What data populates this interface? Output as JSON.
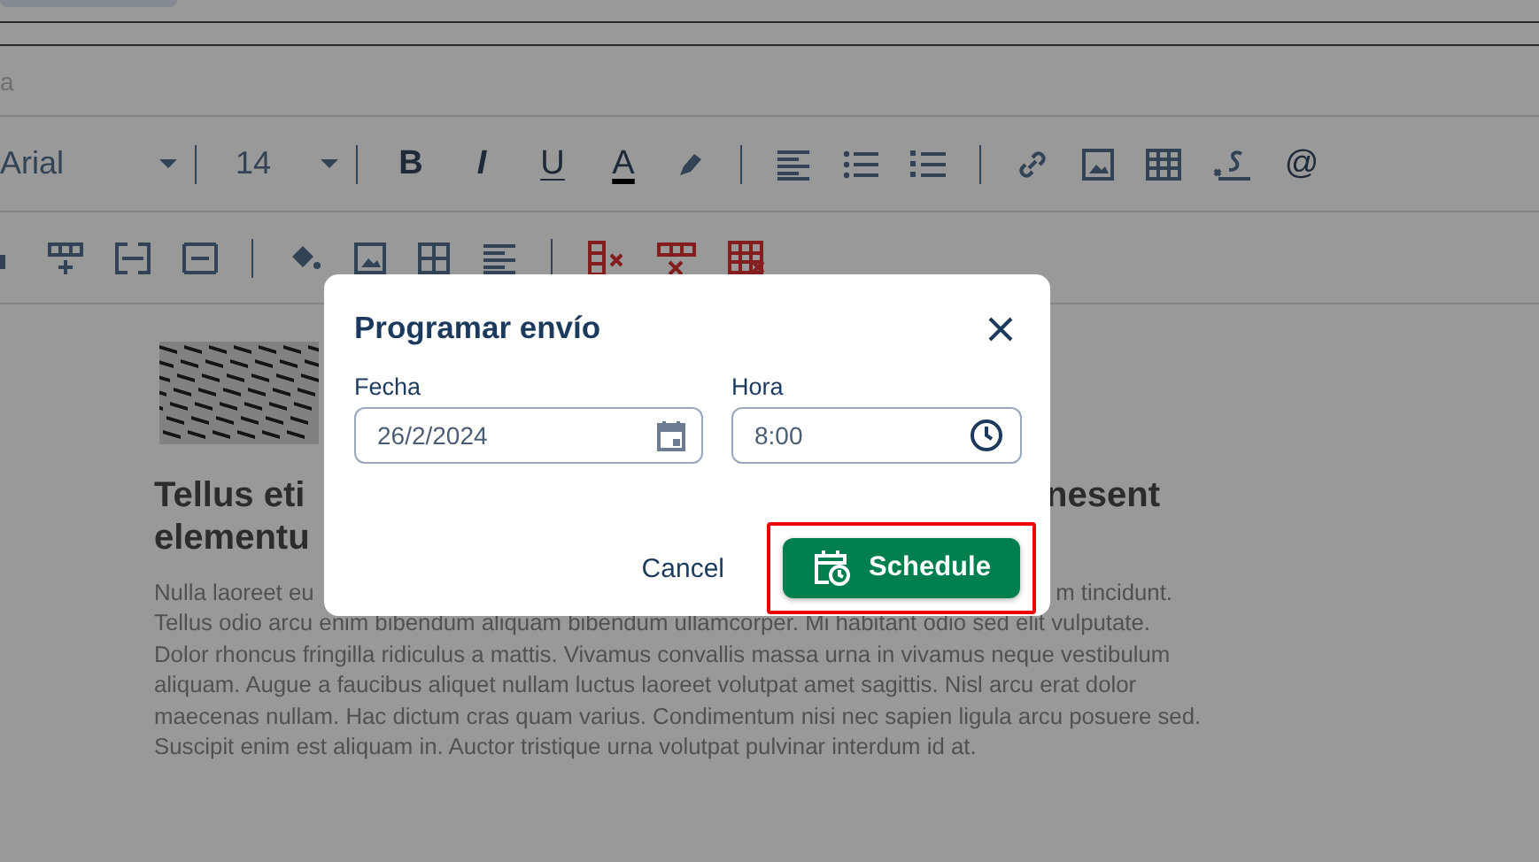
{
  "subject_field": {
    "placeholder": "a"
  },
  "format_toolbar": {
    "font": "Arial",
    "size": "14",
    "bold": "B",
    "italic": "I",
    "underline": "U",
    "text_color": "A",
    "mention": "@"
  },
  "article": {
    "heading_lines": [
      {
        "left": "Tellus eti",
        "right": "nesent"
      },
      {
        "left": "elementu"
      }
    ],
    "first_line": {
      "left": "Nulla laoreet eu",
      "right": "m tincidunt."
    },
    "paragraph": "Tellus odio arcu enim bibendum aliquam bibendum ullamcorper. Mi habitant odio sed elit vulputate. Dolor rhoncus fringilla ridiculus a mattis. Vivamus convallis massa urna in vivamus neque vestibulum aliquam. Augue a faucibus aliquet nullam luctus laoreet volutpat amet sagittis. Nisl arcu erat dolor maecenas nullam. Hac dictum cras quam varius. Condimentum nisi nec sapien ligula arcu posuere sed. Suscipit enim est aliquam in. Auctor tristique urna volutpat pulvinar interdum id at."
  },
  "dialog": {
    "title": "Programar envío",
    "fields": [
      {
        "kind": "date",
        "label": "Fecha",
        "value": "26/2/2024"
      },
      {
        "kind": "time",
        "label": "Hora",
        "value": "8:00"
      }
    ],
    "cancel": "Cancel",
    "schedule": {
      "label": "Schedule",
      "focused": true
    }
  }
}
